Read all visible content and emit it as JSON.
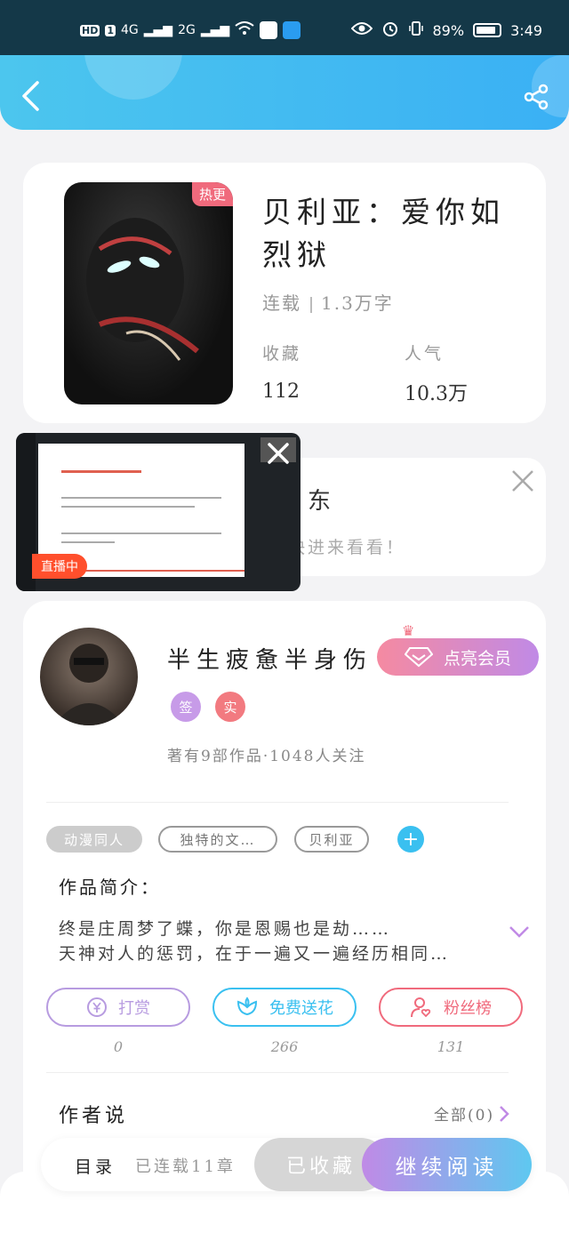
{
  "status_bar": {
    "hd": "HD",
    "sim": "1",
    "net1": "4G",
    "net2": "2G",
    "battery_percent": "89%",
    "battery_level": 0.89,
    "time": "3:49"
  },
  "book": {
    "hot_tag": "热更",
    "title": "贝利亚：爱你如烈狱",
    "status": "连载",
    "word_count": "1.3万字",
    "collect_label": "收藏",
    "collect_value": "112",
    "popularity_label": "人气",
    "popularity_value": "10.3万"
  },
  "popup": {
    "title_fragment": "东",
    "subtitle_fragment": "快进来看看！",
    "live_label": "直播中"
  },
  "author": {
    "name": "半生疲惫半身伤",
    "vip_button": "点亮会员",
    "badge_sign": "签",
    "badge_real": "实",
    "works_summary": "著有9部作品·1048人关注"
  },
  "tags": [
    "动漫同人",
    "独特的文…",
    "贝利亚"
  ],
  "intro": {
    "label": "作品简介：",
    "line1": "终是庄周梦了蝶，你是恩赐也是劫……",
    "line2": "天神对人的惩罚，在于一遍又一遍经历相同…"
  },
  "actions": [
    {
      "label": "打赏",
      "count": "0",
      "color": "#b79be0"
    },
    {
      "label": "免费送花",
      "count": "266",
      "color": "#3ac0f0"
    },
    {
      "label": "粉丝榜",
      "count": "131",
      "color": "#f06a7c"
    }
  ],
  "author_says": {
    "label": "作者说",
    "all_link": "全部(0)"
  },
  "bottom": {
    "toc": "目录",
    "serial": "已连载11章",
    "collected": "已收藏",
    "continue": "继续阅读"
  },
  "colors": {
    "header_start": "#4cc6ee",
    "header_end": "#3ab0f4",
    "accent_pink": "#f06a7c",
    "accent_blue": "#3ac0f0",
    "accent_purple": "#c08ae6"
  }
}
